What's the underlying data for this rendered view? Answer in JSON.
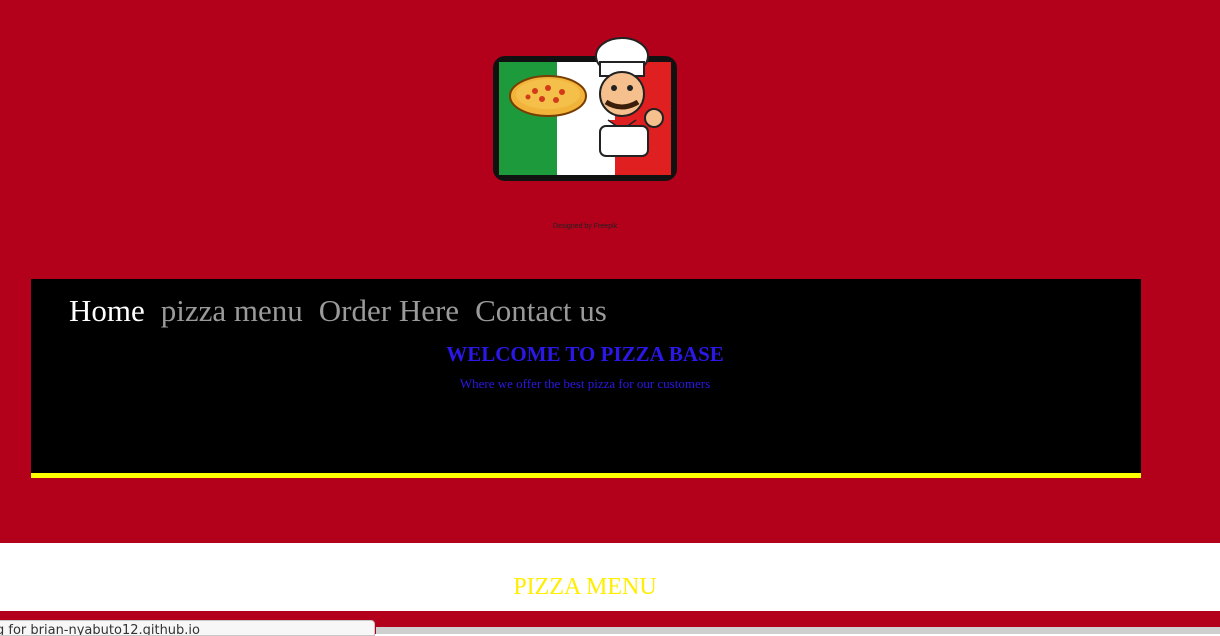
{
  "header": {
    "logo_text": "Pizza",
    "credit": "Designed by Freepik"
  },
  "nav": {
    "items": [
      {
        "label": "Home"
      },
      {
        "label": "pizza menu"
      },
      {
        "label": "Order Here"
      },
      {
        "label": "Contact us"
      }
    ]
  },
  "banner": {
    "welcome": "WELCOME TO PIZZA BASE",
    "tagline": "Where we offer the best pizza for our customers"
  },
  "menu_section": {
    "heading": "PIZZA MENU"
  },
  "status": {
    "text": "g for brian-nyabuto12.github.io"
  },
  "colors": {
    "hero_bg": "#b3001b",
    "nav_active": "#ffffff",
    "nav_inactive": "#9a9a9a",
    "welcome": "#2b17e8",
    "banner_border": "#ffff00",
    "menu_heading": "#ffee00"
  }
}
